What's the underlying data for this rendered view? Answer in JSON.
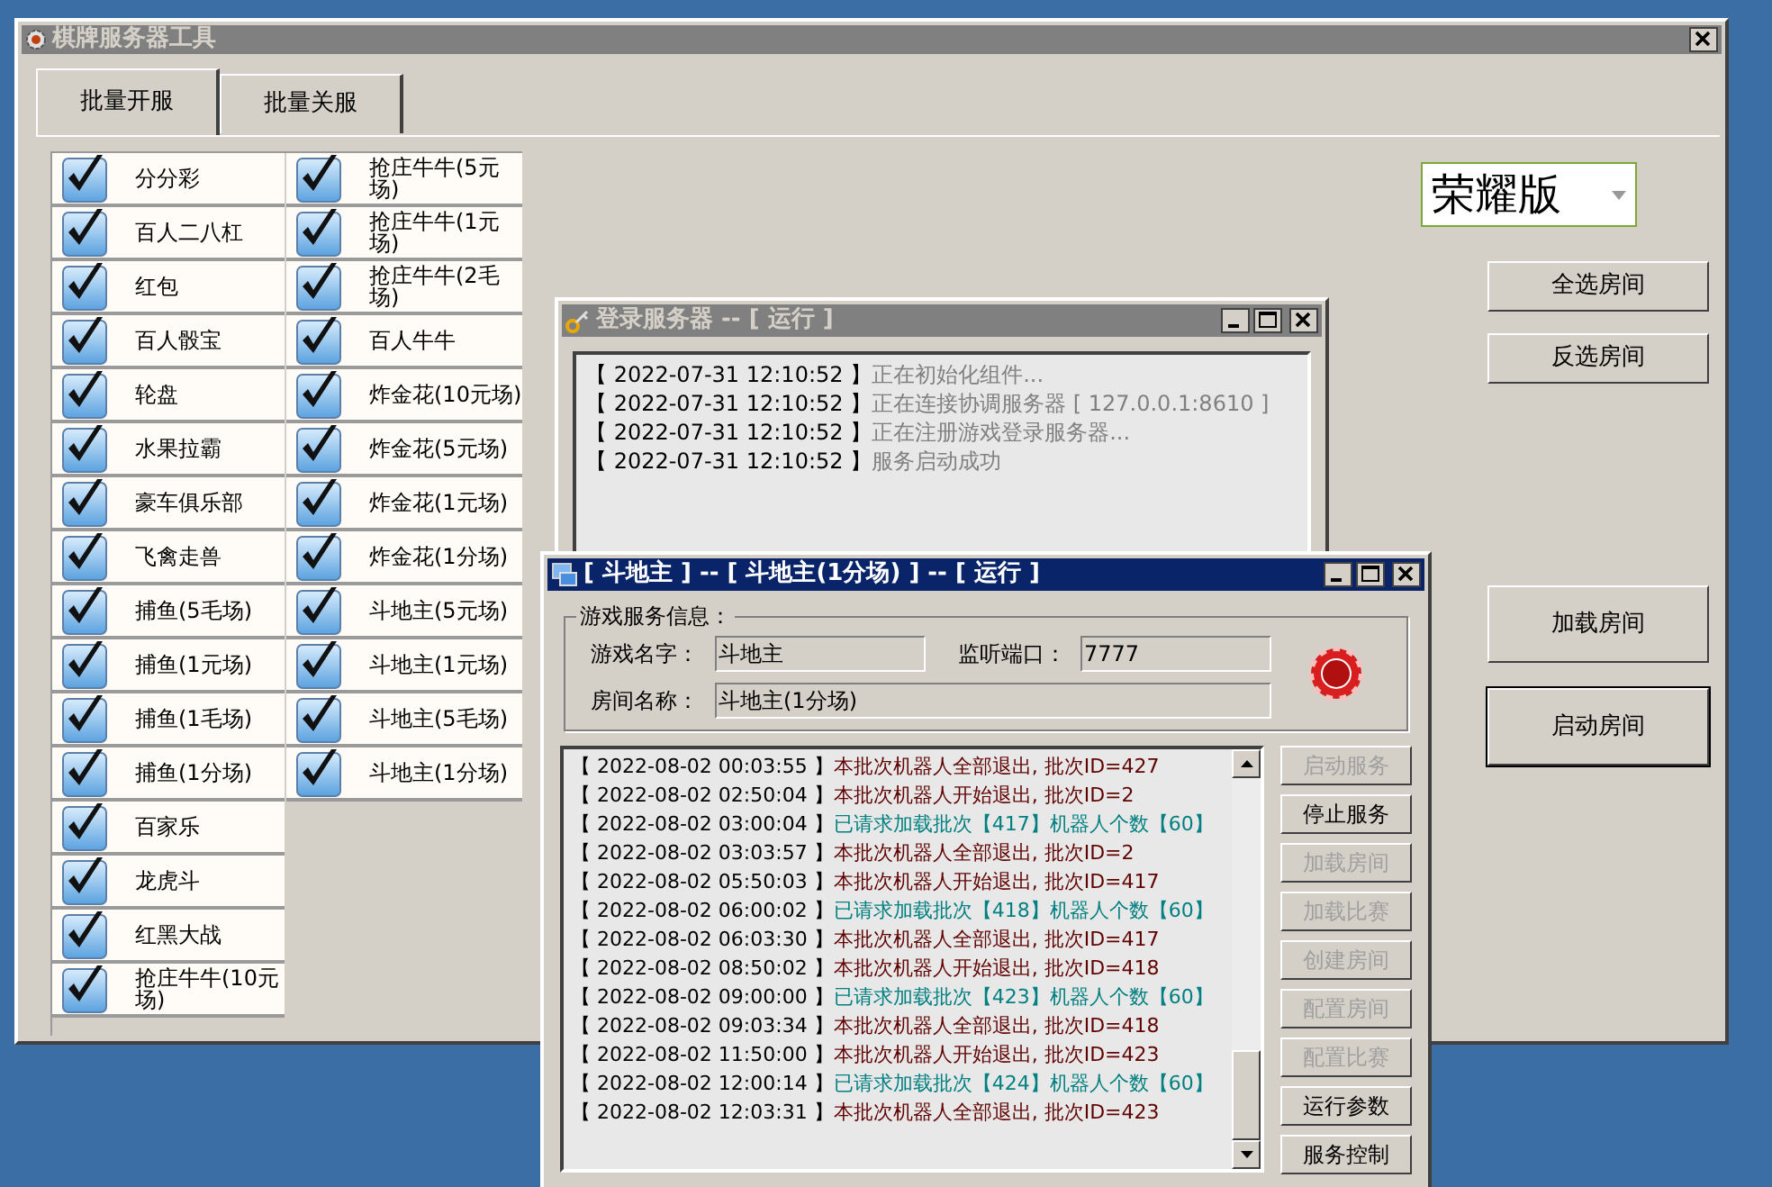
{
  "window": {
    "title": "棋牌服务器工具",
    "active": false
  },
  "tabs": [
    {
      "label": "批量开服",
      "selected": true
    },
    {
      "label": "批量关服",
      "selected": false
    }
  ],
  "rooms_left": [
    {
      "label": "分分彩",
      "checked": true
    },
    {
      "label": "百人二八杠",
      "checked": true
    },
    {
      "label": "红包",
      "checked": true
    },
    {
      "label": "百人骰宝",
      "checked": true
    },
    {
      "label": "轮盘",
      "checked": true
    },
    {
      "label": "水果拉霸",
      "checked": true
    },
    {
      "label": "豪车俱乐部",
      "checked": true
    },
    {
      "label": "飞禽走兽",
      "checked": true
    },
    {
      "label": "捕鱼(5毛场)",
      "checked": true
    },
    {
      "label": "捕鱼(1元场)",
      "checked": true
    },
    {
      "label": "捕鱼(1毛场)",
      "checked": true
    },
    {
      "label": "捕鱼(1分场)",
      "checked": true
    },
    {
      "label": "百家乐",
      "checked": true
    },
    {
      "label": "龙虎斗",
      "checked": true
    },
    {
      "label": "红黑大战",
      "checked": true
    },
    {
      "label": "抢庄牛牛(10元场)",
      "checked": true
    }
  ],
  "rooms_right": [
    {
      "label": "抢庄牛牛(5元场)",
      "checked": true
    },
    {
      "label": "抢庄牛牛(1元场)",
      "checked": true
    },
    {
      "label": "抢庄牛牛(2毛场)",
      "checked": true
    },
    {
      "label": "百人牛牛",
      "checked": true
    },
    {
      "label": "炸金花(10元场)",
      "checked": true
    },
    {
      "label": "炸金花(5元场)",
      "checked": true
    },
    {
      "label": "炸金花(1元场)",
      "checked": true
    },
    {
      "label": "炸金花(1分场)",
      "checked": true
    },
    {
      "label": "斗地主(5元场)",
      "checked": true
    },
    {
      "label": "斗地主(1元场)",
      "checked": true
    },
    {
      "label": "斗地主(5毛场)",
      "checked": true
    },
    {
      "label": "斗地主(1分场)",
      "checked": true
    }
  ],
  "edition_select": {
    "value": "荣耀版"
  },
  "side_buttons": [
    {
      "label": "全选房间",
      "default": false,
      "gap_before": false
    },
    {
      "label": "反选房间",
      "default": false,
      "gap_before": false
    },
    {
      "label": "加载房间",
      "default": false,
      "gap_before": true
    },
    {
      "label": "启动房间",
      "default": true,
      "gap_before": false
    }
  ],
  "login_window": {
    "title": "登录服务器 -- [ 运行 ]",
    "active": false,
    "log": [
      {
        "time": "【 2022-07-31 12:10:52 】",
        "message": "正在初始化组件..."
      },
      {
        "time": "【 2022-07-31 12:10:52 】",
        "message": "正在连接协调服务器 [ 127.0.0.1:8610 ]"
      },
      {
        "time": "【 2022-07-31 12:10:52 】",
        "message": "正在注册游戏登录服务器..."
      },
      {
        "time": "【 2022-07-31 12:10:52 】",
        "message": "服务启动成功"
      }
    ]
  },
  "game_window": {
    "title": "[ 斗地主 ] -- [ 斗地主(1分场) ] -- [ 运行 ]",
    "active": true,
    "group_title": "游戏服务信息：",
    "name_label": "游戏名字：",
    "name_value": "斗地主",
    "port_label": "监听端口：",
    "port_value": "7777",
    "room_label": "房间名称：",
    "room_value": "斗地主(1分场)",
    "log": [
      {
        "time": "【 2022-08-02 00:03:55 】",
        "message": "本批次机器人全部退出, 批次ID=427",
        "kind": "exit"
      },
      {
        "time": "【 2022-08-02 02:50:04 】",
        "message": "本批次机器人开始退出, 批次ID=2",
        "kind": "exit"
      },
      {
        "time": "【 2022-08-02 03:00:04 】",
        "message": "已请求加载批次【417】机器人个数【60】",
        "kind": "load"
      },
      {
        "time": "【 2022-08-02 03:03:57 】",
        "message": "本批次机器人全部退出, 批次ID=2",
        "kind": "exit"
      },
      {
        "time": "【 2022-08-02 05:50:03 】",
        "message": "本批次机器人开始退出, 批次ID=417",
        "kind": "exit"
      },
      {
        "time": "【 2022-08-02 06:00:02 】",
        "message": "已请求加载批次【418】机器人个数【60】",
        "kind": "load"
      },
      {
        "time": "【 2022-08-02 06:03:30 】",
        "message": "本批次机器人全部退出, 批次ID=417",
        "kind": "exit"
      },
      {
        "time": "【 2022-08-02 08:50:02 】",
        "message": "本批次机器人开始退出, 批次ID=418",
        "kind": "exit"
      },
      {
        "time": "【 2022-08-02 09:00:00 】",
        "message": "已请求加载批次【423】机器人个数【60】",
        "kind": "load"
      },
      {
        "time": "【 2022-08-02 09:03:34 】",
        "message": "本批次机器人全部退出, 批次ID=418",
        "kind": "exit"
      },
      {
        "time": "【 2022-08-02 11:50:00 】",
        "message": "本批次机器人开始退出, 批次ID=423",
        "kind": "exit"
      },
      {
        "time": "【 2022-08-02 12:00:14 】",
        "message": "已请求加载批次【424】机器人个数【60】",
        "kind": "load"
      },
      {
        "time": "【 2022-08-02 12:03:31 】",
        "message": "本批次机器人全部退出, 批次ID=423",
        "kind": "exit"
      }
    ],
    "buttons": [
      {
        "label": "启动服务",
        "disabled": true
      },
      {
        "label": "停止服务",
        "disabled": false
      },
      {
        "label": "加载房间",
        "disabled": true
      },
      {
        "label": "加载比赛",
        "disabled": true
      },
      {
        "label": "创建房间",
        "disabled": true
      },
      {
        "label": "配置房间",
        "disabled": true
      },
      {
        "label": "配置比赛",
        "disabled": true
      },
      {
        "label": "运行参数",
        "disabled": false
      },
      {
        "label": "服务控制",
        "disabled": false
      }
    ]
  }
}
